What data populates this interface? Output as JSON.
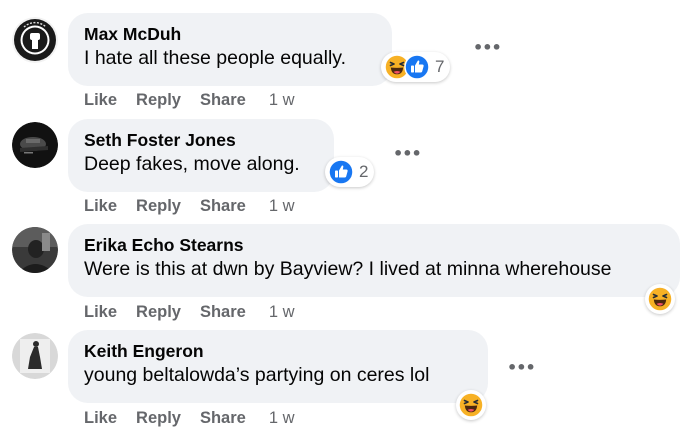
{
  "actions": {
    "like": "Like",
    "reply": "Reply",
    "share": "Share"
  },
  "comments": [
    {
      "author": "Max McDuh",
      "text": "I hate all these people equally.",
      "reaction_count": "7",
      "time": "1 w",
      "reactions": [
        "haha-icon",
        "like-icon"
      ]
    },
    {
      "author": "Seth Foster Jones",
      "text": "Deep fakes, move along.",
      "reaction_count": "2",
      "time": "1 w",
      "reactions": [
        "like-icon"
      ]
    },
    {
      "author": "Erika Echo Stearns",
      "text": "Were is this at dwn by Bayview? I lived at minna wherehouse",
      "time": "1 w",
      "reactions": [
        "haha-icon"
      ]
    },
    {
      "author": "Keith Engeron",
      "text": "young beltalowda’s partying on ceres lol",
      "time": "1 w",
      "reactions": [
        "haha-icon"
      ]
    }
  ],
  "icons": {
    "more": "more-options-icon",
    "like": "like-icon",
    "haha": "haha-icon"
  },
  "colors": {
    "bubble": "#f0f2f5",
    "like_blue": "#1877f2",
    "haha_yellow": "#f7b125",
    "secondary_text": "#65676b"
  }
}
